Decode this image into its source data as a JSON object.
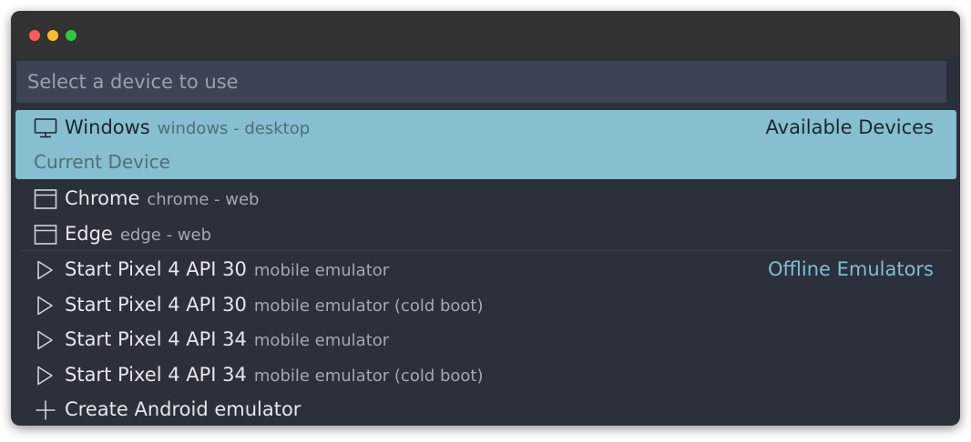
{
  "search": {
    "placeholder": "Select a device to use"
  },
  "items": [
    {
      "icon": "monitor-icon",
      "title": "Windows",
      "desc": "windows - desktop",
      "group": "Available Devices",
      "sublabel": "Current Device",
      "selected": true
    },
    {
      "icon": "browser-window-icon",
      "title": "Chrome",
      "desc": "chrome - web"
    },
    {
      "icon": "browser-window-icon",
      "title": "Edge",
      "desc": "edge - web"
    },
    {
      "icon": "play-icon",
      "title": "Start Pixel 4 API 30",
      "desc": "mobile emulator",
      "group": "Offline Emulators"
    },
    {
      "icon": "play-icon",
      "title": "Start Pixel 4 API 30",
      "desc": "mobile emulator (cold boot)"
    },
    {
      "icon": "play-icon",
      "title": "Start Pixel 4 API 34",
      "desc": "mobile emulator"
    },
    {
      "icon": "play-icon",
      "title": "Start Pixel 4 API 34",
      "desc": "mobile emulator (cold boot)"
    },
    {
      "icon": "plus-icon",
      "title": "Create Android emulator",
      "desc": ""
    }
  ],
  "colors": {
    "selected_bg": "#86bfcf",
    "group_label": "#7fbed0",
    "window_bg": "#2b303b"
  }
}
